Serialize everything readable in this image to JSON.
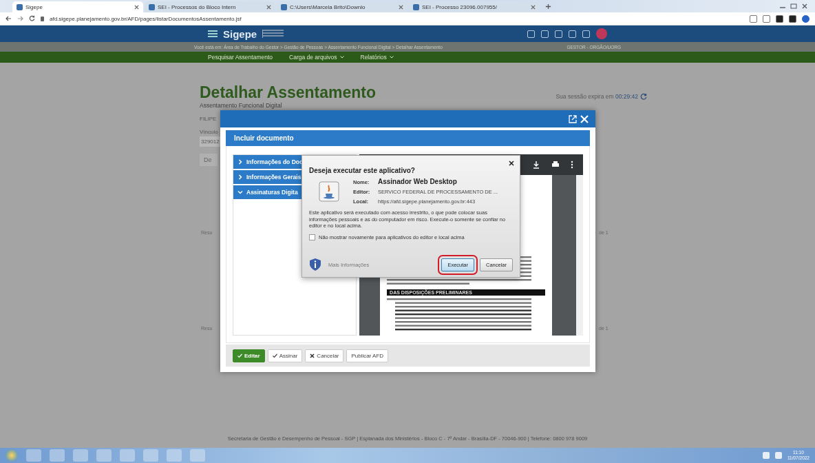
{
  "browser": {
    "tabs": [
      {
        "title": "Sigepe",
        "selected": true
      },
      {
        "title": "SEI - Processos do Bloco Intern",
        "selected": false
      },
      {
        "title": "C:\\Users\\Marcela Brito\\Downlo",
        "selected": false
      },
      {
        "title": "SEI - Processo 23096.007955/",
        "selected": false
      }
    ],
    "address": "afd.sigepe.planejamento.gov.br/AFD/pages/listarDocumentosAssentamento.jsf"
  },
  "header": {
    "logo": "Sigepe"
  },
  "breadcrumb": {
    "text": "Você está em: Área de Trabalho do Gestor > Gestão de Pessoas > Assentamento Funcional Digital > Detalhar Assentamento",
    "user": "GESTOR - ORGÃO/UORG"
  },
  "menu": [
    {
      "label": "Pesquisar Assentamento",
      "dropdown": false
    },
    {
      "label": "Carga de arquivos",
      "dropdown": true
    },
    {
      "label": "Relatórios",
      "dropdown": true
    }
  ],
  "page": {
    "title": "Detalhar Assentamento",
    "subtitle": "Assentamento Funcional Digital",
    "session_label": "Sua sessão expira em",
    "session_time": "00:29:42",
    "name": "FILIPE",
    "vinculo_label": "Vínculo",
    "vinculo_value": "329012",
    "tab": "De",
    "results": [
      "Resu",
      "Resu"
    ],
    "pagers": [
      "de 1",
      "de 1"
    ]
  },
  "modal": {
    "panel_title": "Incluir documento",
    "sections": [
      {
        "label": "Informações do Doc",
        "expanded": false
      },
      {
        "label": "Informações Gerais",
        "expanded": false
      },
      {
        "label": "Assinaturas Digita",
        "expanded": true
      }
    ],
    "pdf_heading": "DAS DISPOSIÇÕES PRELIMINARES",
    "buttons": [
      {
        "label": "Editar",
        "kind": "primary"
      },
      {
        "label": "Assinar",
        "kind": "check"
      },
      {
        "label": "Cancelar",
        "kind": "cancel"
      },
      {
        "label": "Publicar AFD",
        "kind": "plain"
      }
    ]
  },
  "dialog": {
    "title": "Deseja executar este aplicativo?",
    "fields": [
      {
        "label": "Nome:",
        "value": "Assinador Web Desktop",
        "kind": "big"
      },
      {
        "label": "Editor:",
        "value": "SERVICO FEDERAL DE PROCESSAMENTO DE ...",
        "kind": "small"
      },
      {
        "label": "Local:",
        "value": "https://afd.sigepe.planejamento.gov.br:443",
        "kind": "small"
      }
    ],
    "warning": "Este aplicativo será executado com acesso irrestrito, o que pode colocar suas informações pessoais e as do computador em risco. Execute-o somente se confiar no editor e no local acima.",
    "checkbox": {
      "label": "Não mostrar novamente para aplicativos do editor e local acima",
      "checked": false
    },
    "more_info": "Mais Informações",
    "buttons": [
      {
        "label": "Executar",
        "highlighted": true
      },
      {
        "label": "Cancelar",
        "highlighted": false
      }
    ]
  },
  "footer": "Secretaria de Gestão e Desempenho de Pessoal - SGP | Esplanada dos Ministérios - Bloco C - 7º Andar - Brasília-DF - 70046-900 | Telefone: 0800 978 9009",
  "taskbar": {
    "time": "11:10",
    "date": "11/07/2022"
  }
}
